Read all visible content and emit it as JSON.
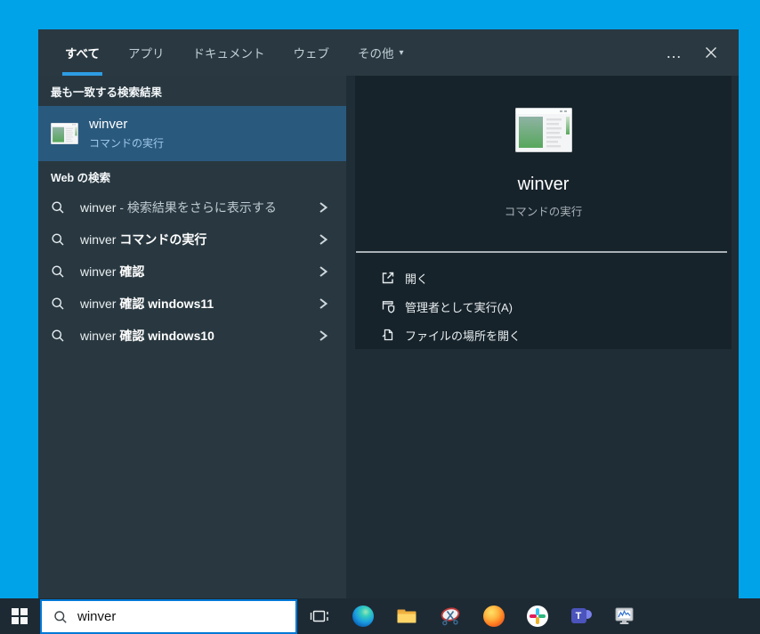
{
  "window": {
    "tabs": [
      {
        "label": "すべて",
        "selected": true
      },
      {
        "label": "アプリ",
        "selected": false
      },
      {
        "label": "ドキュメント",
        "selected": false
      },
      {
        "label": "ウェブ",
        "selected": false
      },
      {
        "label": "その他",
        "selected": false,
        "has_dropdown": true
      }
    ],
    "more_label": "…"
  },
  "left_panel": {
    "best_match_header": "最も一致する検索結果",
    "best_match": {
      "title": "winver",
      "subtitle": "コマンドの実行"
    },
    "web_header": "Web の検索",
    "suggestions": [
      {
        "prefix": "winver",
        "suffix": " - 検索結果をさらに表示する",
        "bold_suffix": false
      },
      {
        "prefix": "winver ",
        "suffix": "コマンドの実行",
        "bold_suffix": true
      },
      {
        "prefix": "winver ",
        "suffix": "確認",
        "bold_suffix": true
      },
      {
        "prefix": "winver ",
        "suffix": "確認 windows11",
        "bold_suffix": true
      },
      {
        "prefix": "winver ",
        "suffix": "確認 windows10",
        "bold_suffix": true
      }
    ]
  },
  "right_panel": {
    "title": "winver",
    "subtitle": "コマンドの実行",
    "actions": [
      {
        "label": "開く",
        "icon": "open-icon"
      },
      {
        "label": "管理者として実行(A)",
        "icon": "run-as-admin-shield-icon"
      },
      {
        "label": "ファイルの場所を開く",
        "icon": "open-file-location-icon"
      }
    ]
  },
  "taskbar": {
    "search_value": "winver",
    "icons": [
      "task-view",
      "edge",
      "file-explorer",
      "snipping-tool",
      "firefox",
      "slack",
      "teams",
      "performance-monitor"
    ]
  },
  "icons": {
    "more": "ellipsis",
    "close": "x",
    "tab_dropdown": "chevron-down",
    "suggestion": "magnifier",
    "suggestion_go": "chevron-right",
    "app": "winver-window"
  },
  "colors": {
    "desktop": "#00a2e8",
    "accent_border": "#0078d7",
    "tab_underline": "#2d9ce3",
    "best_match_highlight": "#2a597e",
    "left_panel": "#293840",
    "right_panel": "#17232b",
    "taskbar": "#1d2a33"
  }
}
